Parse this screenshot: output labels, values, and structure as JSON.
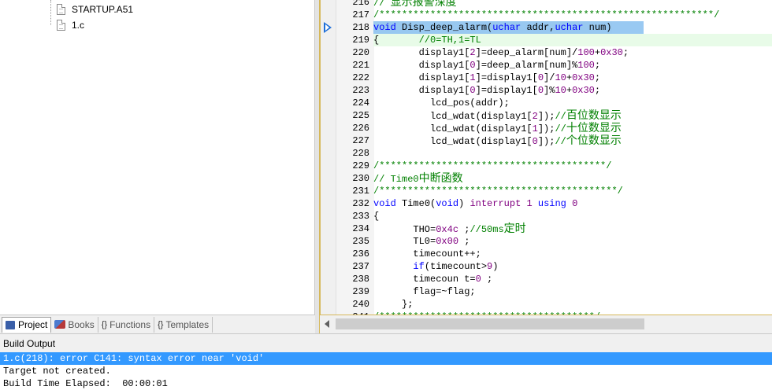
{
  "project": {
    "files": [
      "STARTUP.A51",
      "1.c"
    ],
    "tabs": [
      {
        "label": "Project",
        "icon": "project-icon"
      },
      {
        "label": "Books",
        "icon": "books-icon"
      },
      {
        "label": "Functions",
        "icon": "functions-icon",
        "glyph": "{}"
      },
      {
        "label": "Templates",
        "icon": "templates-icon",
        "glyph": "{}"
      }
    ]
  },
  "editor": {
    "current_line": "218",
    "lines": [
      {
        "n": "216",
        "t": "// 显示报警深度"
      },
      {
        "n": "217",
        "t": "/***********************************************************/"
      },
      {
        "n": "218",
        "t": "void Disp_deep_alarm(uchar addr,uchar num)"
      },
      {
        "n": "219",
        "t": "{       //0=TH,1=TL"
      },
      {
        "n": "220",
        "t": "        display1[2]=deep_alarm[num]/100+0x30;"
      },
      {
        "n": "221",
        "t": "        display1[0]=deep_alarm[num]%100;"
      },
      {
        "n": "222",
        "t": "        display1[1]=display1[0]/10+0x30;"
      },
      {
        "n": "223",
        "t": "        display1[0]=display1[0]%10+0x30;"
      },
      {
        "n": "224",
        "t": "          lcd_pos(addr);"
      },
      {
        "n": "225",
        "t": "          lcd_wdat(display1[2]);//百位数显示"
      },
      {
        "n": "226",
        "t": "          lcd_wdat(display1[1]);//十位数显示"
      },
      {
        "n": "227",
        "t": "          lcd_wdat(display1[0]);//个位数显示"
      },
      {
        "n": "228",
        "t": ""
      },
      {
        "n": "229",
        "t": "/****************************************/"
      },
      {
        "n": "230",
        "t": "// Time0中断函数"
      },
      {
        "n": "231",
        "t": "/******************************************/"
      },
      {
        "n": "232",
        "t": "void Time0(void) interrupt 1 using 0"
      },
      {
        "n": "233",
        "t": "{"
      },
      {
        "n": "234",
        "t": "       THO=0x4c ;//50ms定时"
      },
      {
        "n": "235",
        "t": "       TL0=0x00 ;"
      },
      {
        "n": "236",
        "t": "       timecount++;"
      },
      {
        "n": "237",
        "t": "       if(timecount>9)"
      },
      {
        "n": "238",
        "t": "       timecoun t=0 ;"
      },
      {
        "n": "239",
        "t": "       flag=~flag;"
      },
      {
        "n": "240",
        "t": "     };"
      },
      {
        "n": "241",
        "t": "/**************************************/"
      }
    ]
  },
  "build": {
    "title": "Build Output",
    "lines": [
      "1.c(218): error C141: syntax error near 'void'",
      "Target not created.",
      "Build Time Elapsed:  00:00:01"
    ]
  },
  "colors": {
    "selection": "#3399ff",
    "line_highlight": "#99c9f2",
    "keyword": "#0000ff",
    "comment": "#008000",
    "number": "#800080"
  }
}
